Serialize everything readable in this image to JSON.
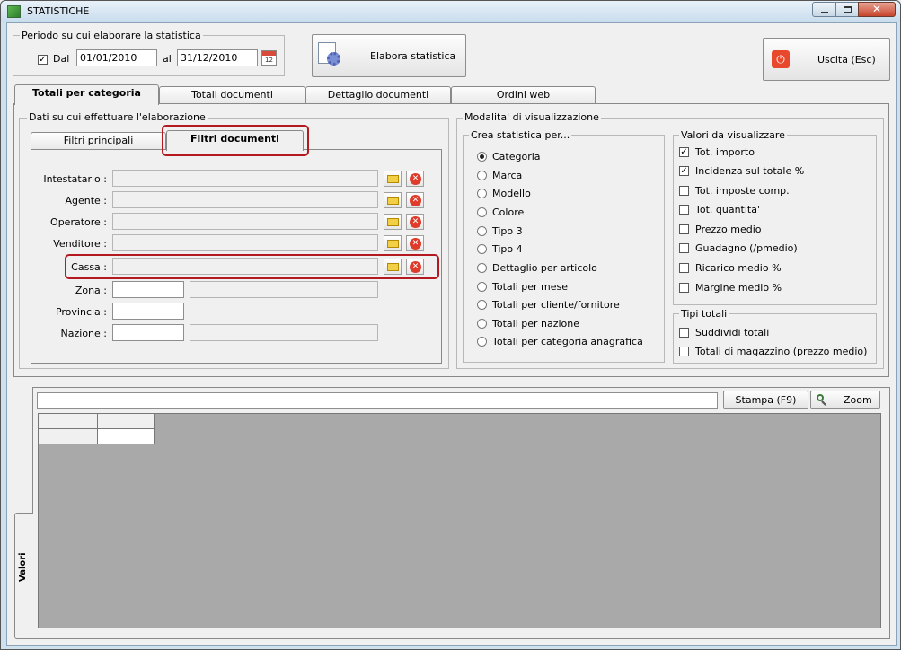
{
  "window": {
    "title": "STATISTICHE"
  },
  "period": {
    "legend": "Periodo su cui elaborare la statistica",
    "dal_checked": true,
    "dal_label": "Dal",
    "from": "01/01/2010",
    "al_label": "al",
    "to": "31/12/2010"
  },
  "toolbar": {
    "elabora_label": "Elabora statistica",
    "exit_label": "Uscita (Esc)"
  },
  "main_tabs": [
    "Totali per categoria",
    "Totali documenti",
    "Dettaglio documenti",
    "Ordini web"
  ],
  "data_group": {
    "legend": "Dati su cui effettuare l'elaborazione",
    "sub_tabs": [
      "Filtri principali",
      "Filtri documenti"
    ],
    "fields": {
      "intestatario": "Intestatario :",
      "agente": "Agente :",
      "operatore": "Operatore :",
      "venditore": "Venditore :",
      "cassa": "Cassa :",
      "zona": "Zona :",
      "provincia": "Provincia :",
      "nazione": "Nazione :"
    }
  },
  "display": {
    "legend": "Modalita' di visualizzazione",
    "crea_legend": "Crea statistica per...",
    "crea_options": [
      "Categoria",
      "Marca",
      "Modello",
      "Colore",
      "Tipo 3",
      "Tipo 4",
      "Dettaglio per articolo",
      "Totali per mese",
      "Totali per cliente/fornitore",
      "Totali per nazione",
      "Totali per categoria anagrafica"
    ],
    "crea_selected": "Categoria",
    "valori_legend": "Valori da visualizzare",
    "valori": [
      {
        "label": "Tot. importo",
        "checked": true
      },
      {
        "label": "Incidenza sul totale %",
        "checked": true
      },
      {
        "label": "Tot. imposte comp.",
        "checked": false
      },
      {
        "label": "Tot. quantita'",
        "checked": false
      },
      {
        "label": "Prezzo medio",
        "checked": false
      },
      {
        "label": "Guadagno (/pmedio)",
        "checked": false
      },
      {
        "label": "Ricarico medio %",
        "checked": false
      },
      {
        "label": "Margine medio %",
        "checked": false
      }
    ],
    "tipi_legend": "Tipi totali",
    "tipi": [
      {
        "label": "Suddividi totali",
        "checked": false
      },
      {
        "label": "Totali di magazzino (prezzo medio)",
        "checked": false
      }
    ]
  },
  "results": {
    "stampa_label": "Stampa (F9)",
    "zoom_label": "Zoom",
    "side_tab": "Valori"
  },
  "icons": {
    "app": "app-chart-icon",
    "calendar": "calendar-icon",
    "elabora": "gear-document-icon",
    "exit": "power-icon",
    "folder": "folder-icon",
    "delete": "delete-icon",
    "zoom": "magnifier-icon"
  },
  "colors": {
    "highlight": "#b3191f",
    "grid_bg": "#a9a9a9",
    "exit_icon": "#e8482c"
  }
}
